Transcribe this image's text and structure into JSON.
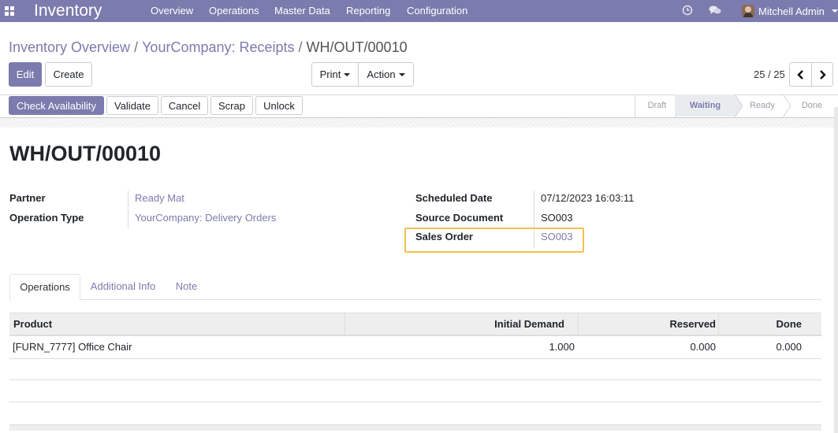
{
  "colors": {
    "brand": "#7c7bad",
    "highlight": "#f0c24f"
  },
  "navbar": {
    "app_icon": "apps-grid-icon",
    "app_name": "Inventory",
    "menu": [
      "Overview",
      "Operations",
      "Master Data",
      "Reporting",
      "Configuration"
    ],
    "icons": [
      "clock-icon",
      "chat-icon"
    ],
    "user": "Mitchell Admin"
  },
  "breadcrumb": [
    "Inventory Overview",
    "YourCompany: Receipts",
    "WH/OUT/00010"
  ],
  "buttons": {
    "edit": "Edit",
    "create": "Create",
    "print": "Print",
    "action": "Action"
  },
  "pager": {
    "value": "25 / 25"
  },
  "header_buttons": [
    "Check Availability",
    "Validate",
    "Cancel",
    "Scrap",
    "Unlock"
  ],
  "stages": {
    "items": [
      "Draft",
      "Waiting",
      "Ready",
      "Done"
    ],
    "active": "Waiting"
  },
  "record": {
    "name": "WH/OUT/00010",
    "partner_label": "Partner",
    "partner": "Ready Mat",
    "operation_type_label": "Operation Type",
    "operation_type": "YourCompany: Delivery Orders",
    "scheduled_date_label": "Scheduled Date",
    "scheduled_date": "07/12/2023 16:03:11",
    "source_document_label": "Source Document",
    "source_document": "SO003",
    "sales_order_label": "Sales Order",
    "sales_order": "SO003"
  },
  "tabs": [
    "Operations",
    "Additional Info",
    "Note"
  ],
  "table": {
    "headers": [
      "Product",
      "Initial Demand",
      "Reserved",
      "Done"
    ],
    "rows": [
      {
        "product": "[FURN_7777] Office Chair",
        "initial_demand": "1.000",
        "reserved": "0.000",
        "done": "0.000"
      }
    ]
  }
}
